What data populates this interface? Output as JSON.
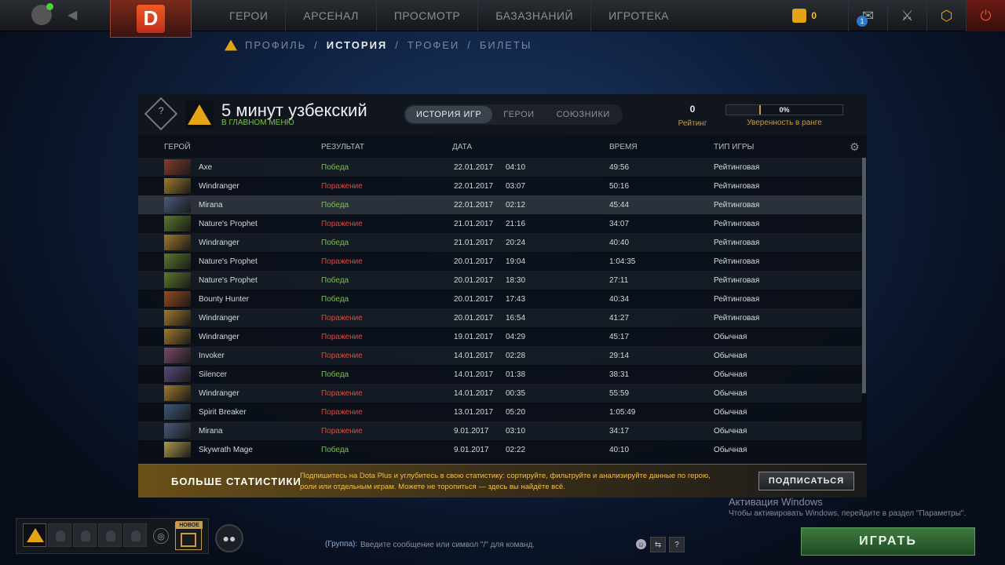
{
  "topbar": {
    "coins": "0",
    "mail_count": "1",
    "nav": [
      "ГЕРОИ",
      "АРСЕНАЛ",
      "ПРОСМОТР",
      "БАЗАЗНАНИЙ",
      "ИГРОТЕКА"
    ],
    "logo_letter": "D"
  },
  "subnav": {
    "items": [
      "ПРОФИЛЬ",
      "ИСТОРИЯ",
      "ТРОФЕИ",
      "БИЛЕТЫ"
    ],
    "separator": "/"
  },
  "profile": {
    "name": "5 минут узбекский",
    "status": "В ГЛАВНОМ МЕНЮ",
    "tabs": [
      "ИСТОРИЯ ИГР",
      "ГЕРОИ",
      "СОЮЗНИКИ"
    ],
    "rating_value": "0",
    "rating_label": "Рейтинг",
    "confidence_value": "0%",
    "confidence_label": "Уверенность в ранге"
  },
  "table": {
    "headers": {
      "hero": "ГЕРОЙ",
      "result": "РЕЗУЛЬТАТ",
      "date": "ДАТА",
      "time": "ВРЕМЯ",
      "type": "ТИП ИГРЫ"
    },
    "rows": [
      {
        "hero": "Axe",
        "result": "Победа",
        "win": true,
        "date": "22.01.2017",
        "clock": "04:10",
        "duration": "49:56",
        "type": "Рейтинговая",
        "color": "#8a3a2a"
      },
      {
        "hero": "Windranger",
        "result": "Поражение",
        "win": false,
        "date": "22.01.2017",
        "clock": "03:07",
        "duration": "50:16",
        "type": "Рейтинговая",
        "color": "#a07a2a"
      },
      {
        "hero": "Mirana",
        "result": "Победа",
        "win": true,
        "date": "22.01.2017",
        "clock": "02:12",
        "duration": "45:44",
        "type": "Рейтинговая",
        "color": "#4a5a7a"
      },
      {
        "hero": "Nature's Prophet",
        "result": "Поражение",
        "win": false,
        "date": "21.01.2017",
        "clock": "21:16",
        "duration": "34:07",
        "type": "Рейтинговая",
        "color": "#5a7a2a"
      },
      {
        "hero": "Windranger",
        "result": "Победа",
        "win": true,
        "date": "21.01.2017",
        "clock": "20:24",
        "duration": "40:40",
        "type": "Рейтинговая",
        "color": "#a07a2a"
      },
      {
        "hero": "Nature's Prophet",
        "result": "Поражение",
        "win": false,
        "date": "20.01.2017",
        "clock": "19:04",
        "duration": "1:04:35",
        "type": "Рейтинговая",
        "color": "#5a7a2a"
      },
      {
        "hero": "Nature's Prophet",
        "result": "Победа",
        "win": true,
        "date": "20.01.2017",
        "clock": "18:30",
        "duration": "27:11",
        "type": "Рейтинговая",
        "color": "#5a7a2a"
      },
      {
        "hero": "Bounty Hunter",
        "result": "Победа",
        "win": true,
        "date": "20.01.2017",
        "clock": "17:43",
        "duration": "40:34",
        "type": "Рейтинговая",
        "color": "#9a4a1a"
      },
      {
        "hero": "Windranger",
        "result": "Поражение",
        "win": false,
        "date": "20.01.2017",
        "clock": "16:54",
        "duration": "41:27",
        "type": "Рейтинговая",
        "color": "#a07a2a"
      },
      {
        "hero": "Windranger",
        "result": "Поражение",
        "win": false,
        "date": "19.01.2017",
        "clock": "04:29",
        "duration": "45:17",
        "type": "Обычная",
        "color": "#a07a2a"
      },
      {
        "hero": "Invoker",
        "result": "Поражение",
        "win": false,
        "date": "14.01.2017",
        "clock": "02:28",
        "duration": "29:14",
        "type": "Обычная",
        "color": "#7a4a6a"
      },
      {
        "hero": "Silencer",
        "result": "Победа",
        "win": true,
        "date": "14.01.2017",
        "clock": "01:38",
        "duration": "38:31",
        "type": "Обычная",
        "color": "#5a4a7a"
      },
      {
        "hero": "Windranger",
        "result": "Поражение",
        "win": false,
        "date": "14.01.2017",
        "clock": "00:35",
        "duration": "55:59",
        "type": "Обычная",
        "color": "#a07a2a"
      },
      {
        "hero": "Spirit Breaker",
        "result": "Поражение",
        "win": false,
        "date": "13.01.2017",
        "clock": "05:20",
        "duration": "1:05:49",
        "type": "Обычная",
        "color": "#3a5a7a"
      },
      {
        "hero": "Mirana",
        "result": "Поражение",
        "win": false,
        "date": "9.01.2017",
        "clock": "03:10",
        "duration": "34:17",
        "type": "Обычная",
        "color": "#4a5a7a"
      },
      {
        "hero": "Skywrath Mage",
        "result": "Победа",
        "win": true,
        "date": "9.01.2017",
        "clock": "02:22",
        "duration": "40:10",
        "type": "Обычная",
        "color": "#b09a4a"
      }
    ]
  },
  "promo": {
    "title": "БОЛЬШЕ СТАТИСТИКИ",
    "text": "Подпишитесь на Dota Plus и углубитесь в свою статистику: сортируйте, фильтруйте и анализируйте данные по герою, роли или отдельным играм. Можете не торопиться — здесь вы найдёте всё.",
    "button": "ПОДПИСАТЬСЯ"
  },
  "watermark": {
    "title": "Активация Windows",
    "text": "Чтобы активировать Windows, перейдите в раздел \"Параметры\"."
  },
  "bottom": {
    "new_badge": "НОВОЕ",
    "chat_group": "(Группа):",
    "chat_placeholder": "Введите сообщение или символ \"/\" для команд.",
    "help": "?",
    "play": "ИГРАТЬ"
  }
}
